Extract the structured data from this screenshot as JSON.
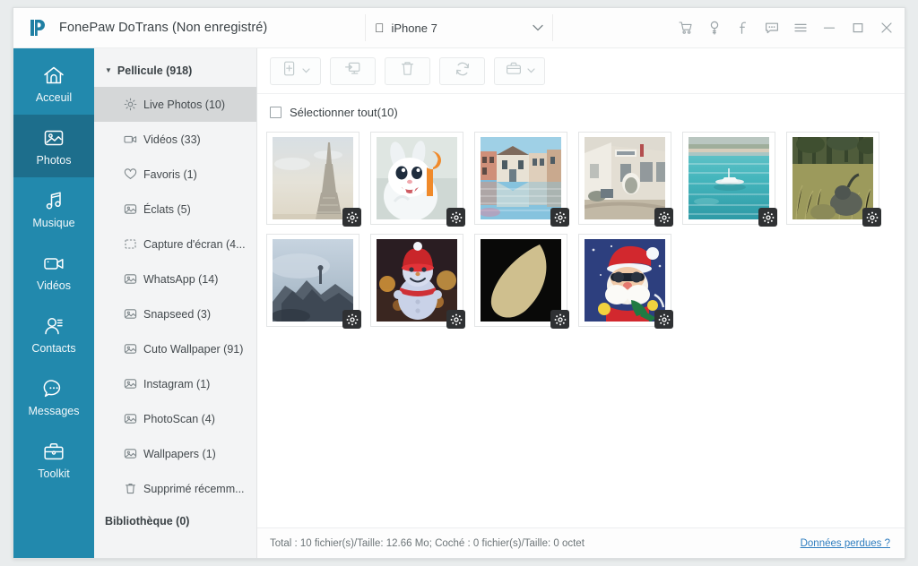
{
  "window": {
    "app_title": "FonePaw DoTrans (Non enregistré)",
    "logo_icon": "fonepaw-logo-icon",
    "device": {
      "apple_icon": "apple-icon",
      "name": "iPhone 7",
      "chevron_icon": "chevron-down-icon"
    },
    "controls": [
      {
        "name": "cart-icon",
        "glyph": "cart"
      },
      {
        "name": "key-icon",
        "glyph": "key"
      },
      {
        "name": "facebook-icon",
        "glyph": "facebook"
      },
      {
        "name": "feedback-chat-icon",
        "glyph": "chat"
      },
      {
        "name": "menu-icon",
        "glyph": "hamburger"
      },
      {
        "name": "minimize-button",
        "glyph": "minimize"
      },
      {
        "name": "maximize-button",
        "glyph": "maximize"
      },
      {
        "name": "close-button",
        "glyph": "close"
      }
    ]
  },
  "sidebar": {
    "items": [
      {
        "label": "Acceuil",
        "icon": "home-icon",
        "active": false
      },
      {
        "label": "Photos",
        "icon": "photo-icon",
        "active": true
      },
      {
        "label": "Musique",
        "icon": "music-icon",
        "active": false
      },
      {
        "label": "Vidéos",
        "icon": "video-icon",
        "active": false
      },
      {
        "label": "Contacts",
        "icon": "contacts-icon",
        "active": false
      },
      {
        "label": "Messages",
        "icon": "messages-icon",
        "active": false
      },
      {
        "label": "Toolkit",
        "icon": "toolkit-icon",
        "active": false
      }
    ]
  },
  "tree": {
    "header": {
      "label": "Pellicule (918)",
      "caret_icon": "caret-down-icon"
    },
    "items": [
      {
        "label": "Live Photos (10)",
        "icon": "live-photos-icon",
        "selected": true
      },
      {
        "label": "Vidéos (33)",
        "icon": "video-icon",
        "selected": false
      },
      {
        "label": "Favoris (1)",
        "icon": "heart-icon",
        "selected": false
      },
      {
        "label": "Éclats (5)",
        "icon": "album-icon",
        "selected": false
      },
      {
        "label": "Capture d'écran (4...",
        "icon": "screenshot-icon",
        "selected": false
      },
      {
        "label": "WhatsApp (14)",
        "icon": "album-icon",
        "selected": false
      },
      {
        "label": "Snapseed (3)",
        "icon": "album-icon",
        "selected": false
      },
      {
        "label": "Cuto Wallpaper (91)",
        "icon": "album-icon",
        "selected": false
      },
      {
        "label": "Instagram (1)",
        "icon": "album-icon",
        "selected": false
      },
      {
        "label": "PhotoScan (4)",
        "icon": "album-icon",
        "selected": false
      },
      {
        "label": "Wallpapers (1)",
        "icon": "album-icon",
        "selected": false
      },
      {
        "label": "Supprimé récemm...",
        "icon": "trash-icon",
        "selected": false
      }
    ],
    "footer": {
      "label": "Bibliothèque (0)"
    }
  },
  "toolbar": {
    "buttons": [
      {
        "name": "add-to-device-button",
        "icon": "phone-plus-icon",
        "has_caret": true
      },
      {
        "name": "export-to-pc-button",
        "icon": "export-monitor-icon",
        "has_caret": false
      },
      {
        "name": "delete-button",
        "icon": "trash-icon",
        "has_caret": false
      },
      {
        "name": "refresh-button",
        "icon": "refresh-icon",
        "has_caret": false
      },
      {
        "name": "toolbox-button",
        "icon": "toolbox-icon",
        "has_caret": true
      }
    ]
  },
  "select_all": {
    "label": "Sélectionner tout(10)",
    "checked": false
  },
  "photos": [
    {
      "name": "eiffel-tower-photo",
      "live": true
    },
    {
      "name": "white-rabbit-photo",
      "live": true
    },
    {
      "name": "canal-houses-photo",
      "live": true
    },
    {
      "name": "street-building-photo",
      "live": true
    },
    {
      "name": "turquoise-sea-boat-photo",
      "live": true
    },
    {
      "name": "forest-grass-photo",
      "live": true
    },
    {
      "name": "foggy-rocks-photo",
      "live": true
    },
    {
      "name": "snowman-photo",
      "live": true
    },
    {
      "name": "black-leaf-photo",
      "live": true
    },
    {
      "name": "santa-claus-photo",
      "live": true
    }
  ],
  "statusbar": {
    "total_text": "Total : 10 fichier(s)/Taille: 12.66 Mo; Coché : 0 fichier(s)/Taille: 0 octet",
    "lost_data_link": "Données perdues ?"
  },
  "colors": {
    "sidebar": "#2289ad",
    "sidebar_active": "#1d6e8c",
    "link": "#2f7dbf",
    "tree_selected": "#d5d7d8"
  }
}
